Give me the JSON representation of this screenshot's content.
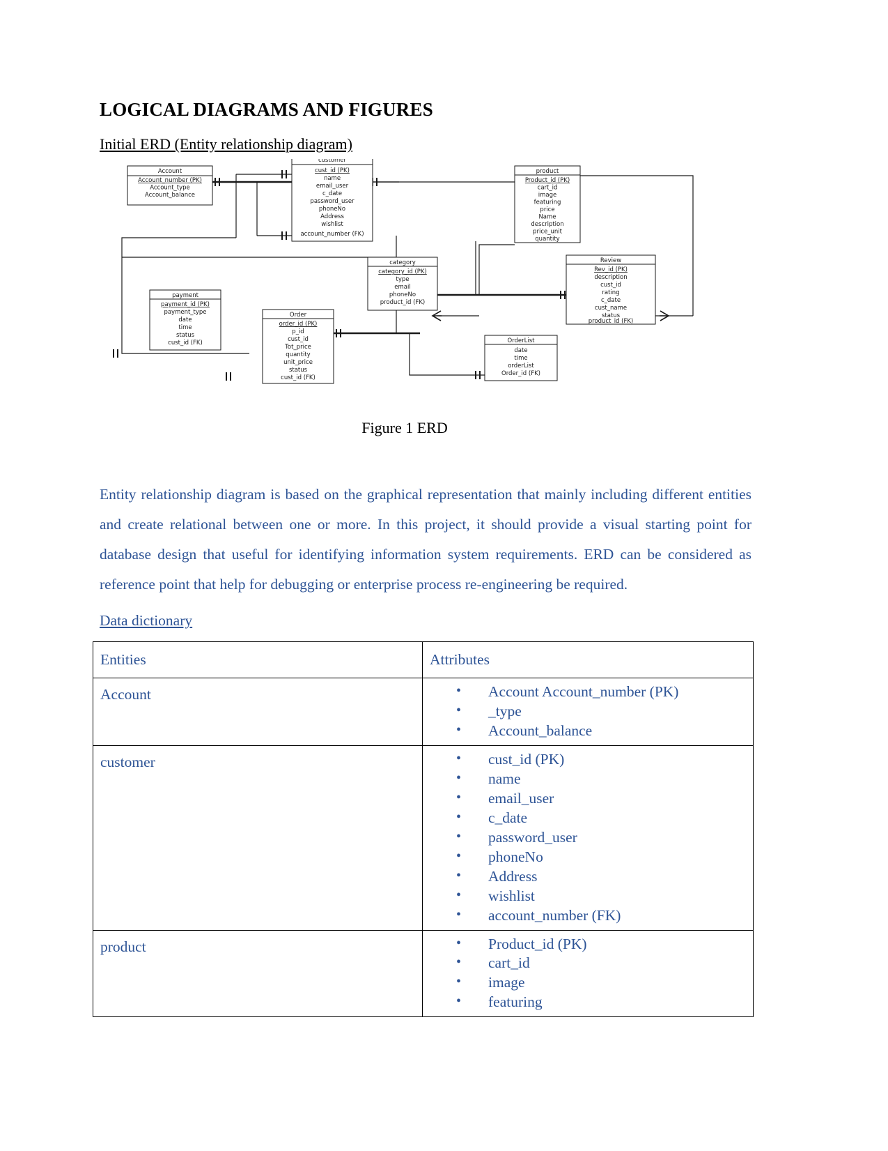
{
  "document": {
    "title": "LOGICAL DIAGRAMS AND FIGURES",
    "sub_heading": "Initial ERD (Entity relationship diagram)",
    "figure_caption": "Figure 1 ERD",
    "body_paragraph": "Entity relationship diagram is based on the graphical representation that mainly including different entities and create relational between one or more. In this project, it should provide a visual starting point for database design that useful for identifying information system requirements. ERD can be considered as reference point that help for debugging or enterprise process re-engineering be required.",
    "data_dictionary_heading": "Data dictionary ",
    "text_color": "#2e5496",
    "heading_color": "#000000"
  },
  "erd": {
    "entities": [
      {
        "id": "account",
        "name": "Account",
        "attributes": [
          "Account_number (PK)",
          "Account_type",
          "Account_balance"
        ],
        "pk_index": 0
      },
      {
        "id": "customer",
        "name": "customer",
        "attributes": [
          "cust_id (PK)",
          "name",
          "email_user",
          "c_date",
          "password_user",
          "phoneNo",
          "Address",
          "wishlist",
          "account_number (FK)"
        ],
        "pk_index": 0
      },
      {
        "id": "product",
        "name": "product",
        "attributes": [
          "Product_id (PK)",
          "cart_id",
          "image",
          "featuring",
          "price",
          "Name",
          "description",
          "price_unit",
          "quantity"
        ],
        "pk_index": 0
      },
      {
        "id": "review",
        "name": "Review",
        "attributes": [
          "Rev_id (PK)",
          "description",
          "cust_id",
          "rating",
          "c_date",
          "cust_name",
          "status",
          "product_id (FK)"
        ],
        "pk_index": 0
      },
      {
        "id": "category",
        "name": "category",
        "attributes": [
          "category_id (PK)",
          "type",
          "email",
          "phoneNo",
          "product_id (FK)"
        ],
        "pk_index": 0
      },
      {
        "id": "payment",
        "name": "payment",
        "attributes": [
          "payment_id (PK)",
          "payment_type",
          "date",
          "time",
          "status",
          "cust_id (FK)"
        ],
        "pk_index": 0
      },
      {
        "id": "order",
        "name": "Order",
        "attributes": [
          "order_id (PK)",
          "p_id",
          "cust_id",
          "Tot_price",
          "quantity",
          "unit_price",
          "status",
          "cust_id (FK)"
        ],
        "pk_index": 0
      },
      {
        "id": "orderlist",
        "name": "OrderList",
        "attributes": [
          "date",
          "time",
          "orderList",
          "Order_id (FK)"
        ],
        "pk_index": -1
      }
    ]
  },
  "data_dictionary": {
    "columns": [
      "Entities",
      "Attributes"
    ],
    "rows": [
      {
        "entity": "Account",
        "attributes": [
          "Account Account_number (PK)",
          "_type",
          "Account_balance"
        ]
      },
      {
        "entity": "customer",
        "attributes": [
          "cust_id (PK)",
          "name",
          "email_user",
          "c_date",
          "password_user",
          "phoneNo",
          "Address",
          "wishlist",
          "account_number (FK)"
        ]
      },
      {
        "entity": "product",
        "attributes": [
          "Product_id (PK)",
          "cart_id",
          "image",
          "featuring"
        ]
      }
    ]
  }
}
